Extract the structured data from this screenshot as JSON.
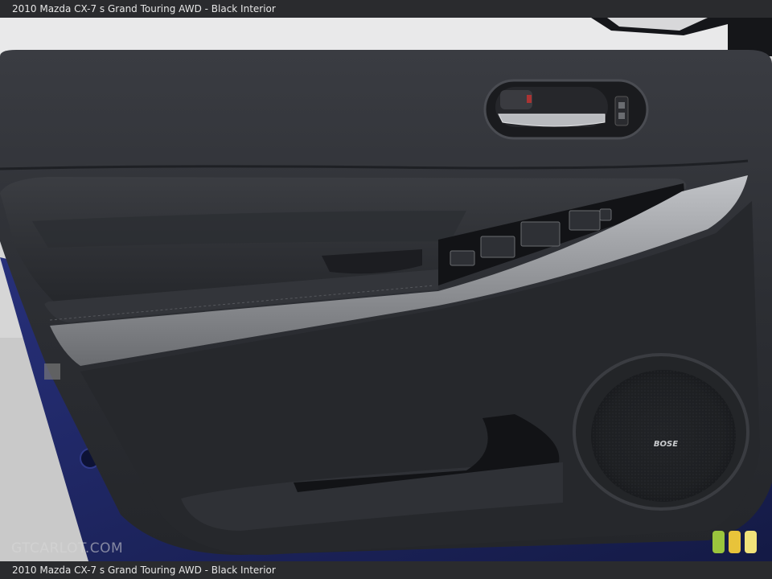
{
  "caption": {
    "top": "2010 Mazda CX-7 s Grand Touring AWD - Black Interior",
    "bottom": "2010 Mazda CX-7 s Grand Touring AWD - Black Interior"
  },
  "watermark": "GTCARLOT.COM",
  "speaker_brand": "BOSE",
  "colors": {
    "door_panel": "#2e3036",
    "trim_silver": "#9a9ca0",
    "body_paint": "#1c2358",
    "badge_green": "#9bc53d",
    "badge_yellow": "#e8c33a",
    "badge_light": "#f1e27a"
  }
}
